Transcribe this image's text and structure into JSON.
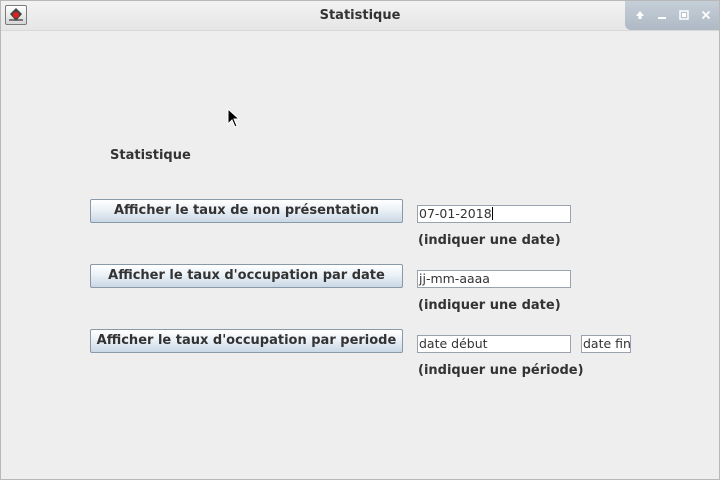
{
  "window": {
    "title": "Statistique"
  },
  "main": {
    "heading": "Statistique",
    "rows": [
      {
        "button_label": "Afficher le taux de non présentation",
        "field_value": "07-01-2018",
        "hint": "(indiquer une date)"
      },
      {
        "button_label": "Afficher le taux d'occupation par date",
        "field_value": "jj-mm-aaaa",
        "hint": "(indiquer une date)"
      },
      {
        "button_label": "Afficher le taux d'occupation par periode",
        "field_value": "date début",
        "field2_value": "date fin",
        "hint": "(indiquer une période)"
      }
    ]
  },
  "icons": {
    "app": "java-app-icon",
    "controls": [
      "up-arrow-icon",
      "minimize-icon",
      "maximize-icon",
      "close-icon"
    ]
  }
}
